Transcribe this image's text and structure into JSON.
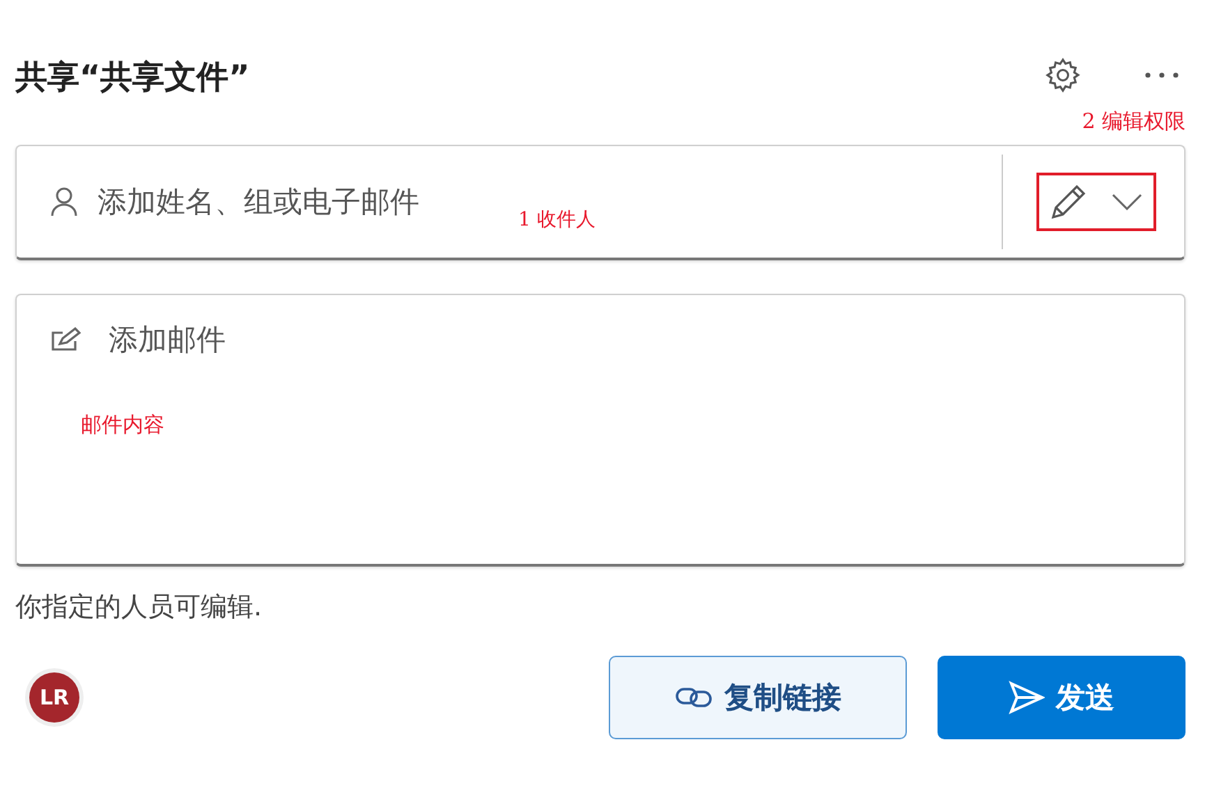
{
  "title": "共享“共享文件”",
  "annotations": [
    {
      "kind": "callout",
      "text": "2 编辑权限"
    },
    {
      "kind": "callout",
      "text": "1 收件人"
    },
    {
      "kind": "callout",
      "text": "邮件内容"
    }
  ],
  "recipients": {
    "placeholder": "添加姓名、组或电子邮件"
  },
  "permission": {
    "highlighted": true
  },
  "message": {
    "placeholder": "添加邮件"
  },
  "note": "你指定的人员可编辑.",
  "avatar": {
    "initials": "LR"
  },
  "buttons": [
    {
      "kind": "secondary",
      "label": "复制链接"
    },
    {
      "kind": "primary",
      "label": "发送"
    }
  ]
}
